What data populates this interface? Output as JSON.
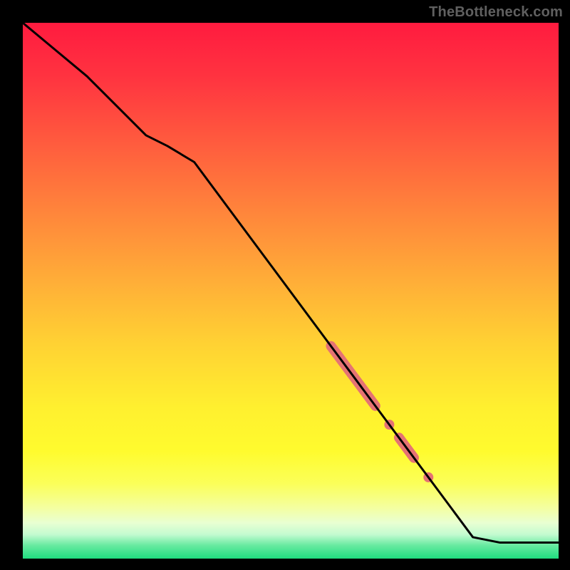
{
  "attribution": "TheBottleneck.com",
  "gradient_stops": [
    {
      "offset": 0.0,
      "color": "#ff1b3f"
    },
    {
      "offset": 0.1,
      "color": "#ff3340"
    },
    {
      "offset": 0.22,
      "color": "#ff5a3e"
    },
    {
      "offset": 0.35,
      "color": "#ff843b"
    },
    {
      "offset": 0.48,
      "color": "#ffad38"
    },
    {
      "offset": 0.6,
      "color": "#ffd233"
    },
    {
      "offset": 0.72,
      "color": "#fff02f"
    },
    {
      "offset": 0.8,
      "color": "#fffb2e"
    },
    {
      "offset": 0.86,
      "color": "#fbff59"
    },
    {
      "offset": 0.905,
      "color": "#f4ffa0"
    },
    {
      "offset": 0.933,
      "color": "#e9ffd2"
    },
    {
      "offset": 0.955,
      "color": "#c3fbd0"
    },
    {
      "offset": 0.975,
      "color": "#69eaa1"
    },
    {
      "offset": 1.0,
      "color": "#1fdd7f"
    }
  ],
  "chart_data": {
    "type": "line",
    "title": "",
    "xlabel": "",
    "ylabel": "",
    "xlim": [
      0,
      100
    ],
    "ylim": [
      0,
      100
    ],
    "grid": false,
    "line": {
      "x": [
        0,
        6,
        12,
        18,
        23,
        27,
        32,
        84,
        89,
        100
      ],
      "y": [
        100,
        95,
        90,
        84,
        79,
        77,
        74,
        4,
        3,
        3
      ]
    },
    "markers": [
      {
        "x_range": [
          57.5,
          65.8
        ],
        "style": "thick-segment",
        "color": "#e57373"
      },
      {
        "x_range": [
          68.0,
          68.8
        ],
        "style": "dot",
        "color": "#e57373"
      },
      {
        "x_range": [
          70.2,
          73.0
        ],
        "style": "thick-segment",
        "color": "#e57373"
      },
      {
        "x_range": [
          75.3,
          76.1
        ],
        "style": "dot",
        "color": "#e57373"
      }
    ]
  }
}
